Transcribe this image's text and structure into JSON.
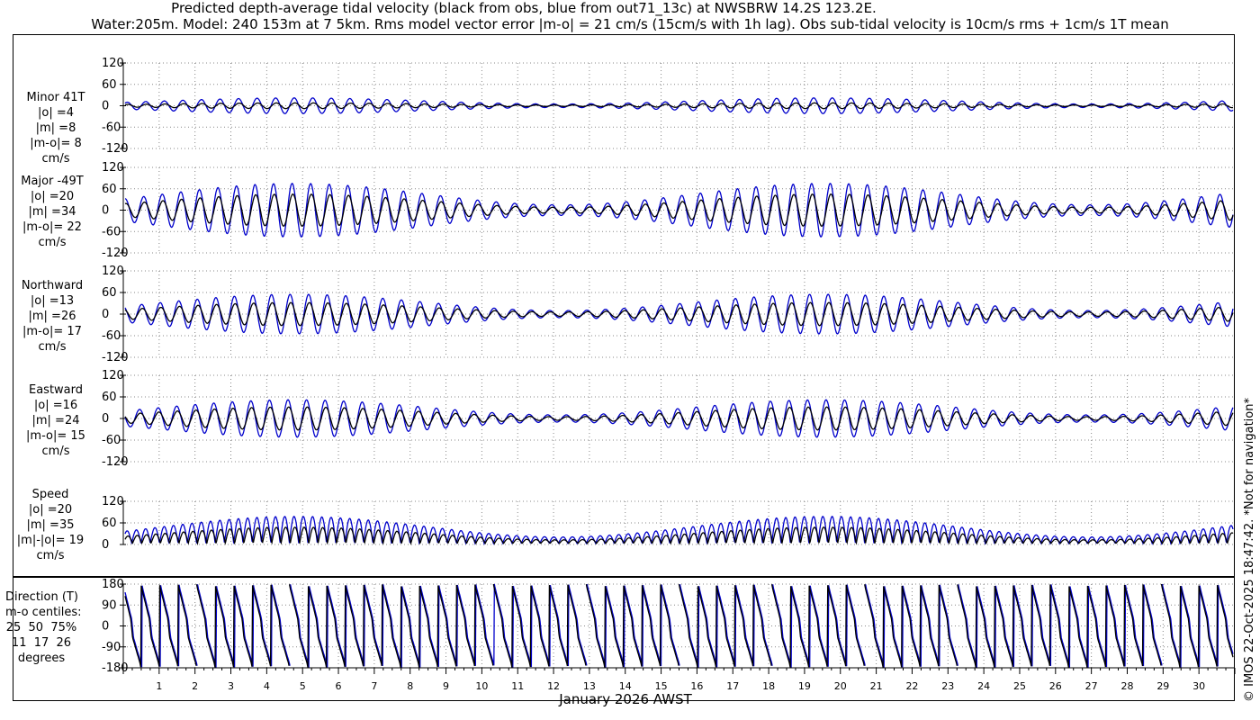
{
  "title_line1": "Predicted depth-average tidal velocity (black from obs, blue from out71_13c) at NWSBRW 14.2S 123.2E.",
  "title_line2": "Water:205m. Model: 240 153m at 7 5km. Rms model vector error |m-o| = 21 cm/s (15cm/s with 1h lag). Obs sub-tidal velocity is 10cm/s rms + 1cm/s 1T mean",
  "xlabel": "January 2026 AWST",
  "copyright": "© IMOS 22-Oct-2025 18:47:42. *Not for navigation*",
  "colors": {
    "obs": "#000000",
    "model": "#0000cc",
    "grid": "#888888"
  },
  "chart_data": [
    {
      "type": "line",
      "name_label": [
        "Minor 41T",
        "|o| =4",
        "|m| =8",
        "|m-o|= 8",
        "cm/s"
      ],
      "yticks": [
        -120,
        -60,
        0,
        60,
        120
      ],
      "ylim": [
        -120,
        120
      ],
      "xlim": [
        0,
        31
      ],
      "xticks": [
        1,
        2,
        3,
        4,
        5,
        6,
        7,
        8,
        9,
        10,
        11,
        12,
        13,
        14,
        15,
        16,
        17,
        18,
        19,
        20,
        21,
        22,
        23,
        24,
        25,
        26,
        27,
        28,
        29,
        30
      ],
      "series": [
        {
          "amplitude_peak": 8,
          "amplitude_neap": 2
        },
        {
          "amplitude_peak": 22,
          "amplitude_neap": 5
        }
      ]
    },
    {
      "type": "line",
      "name_label": [
        "Major -49T",
        "|o| =20",
        "|m| =34",
        "|m-o|= 22",
        "cm/s"
      ],
      "yticks": [
        -120,
        -60,
        0,
        60,
        120
      ],
      "ylim": [
        -120,
        120
      ],
      "series": [
        {
          "amplitude_peak": 45,
          "amplitude_neap": 8
        },
        {
          "amplitude_peak": 75,
          "amplitude_neap": 15
        }
      ]
    },
    {
      "type": "line",
      "name_label": [
        "Northward",
        "|o| =13",
        "|m| =26",
        "|m-o|= 17",
        "cm/s"
      ],
      "yticks": [
        -120,
        -60,
        0,
        60,
        120
      ],
      "ylim": [
        -120,
        120
      ],
      "series": [
        {
          "amplitude_peak": 32,
          "amplitude_neap": 6
        },
        {
          "amplitude_peak": 55,
          "amplitude_neap": 10
        }
      ]
    },
    {
      "type": "line",
      "name_label": [
        "Eastward",
        "|o| =16",
        "|m| =24",
        "|m-o|= 15",
        "cm/s"
      ],
      "yticks": [
        -120,
        -60,
        0,
        60,
        120
      ],
      "ylim": [
        -120,
        120
      ],
      "series": [
        {
          "amplitude_peak": 32,
          "amplitude_neap": 5
        },
        {
          "amplitude_peak": 52,
          "amplitude_neap": 10
        }
      ]
    },
    {
      "type": "line",
      "name_label": [
        "Speed",
        "|o| =20",
        "|m| =35",
        "|m|-|o|= 19",
        "cm/s"
      ],
      "yticks": [
        0,
        60,
        120
      ],
      "ylim": [
        0,
        120
      ],
      "series": [
        {
          "amplitude_peak": 45,
          "amplitude_neap": 10
        },
        {
          "amplitude_peak": 75,
          "amplitude_neap": 18
        }
      ]
    },
    {
      "type": "line",
      "name_label": [
        "Direction (T)",
        "m-o centiles:",
        "25  50  75%",
        "11  17  26",
        "degrees"
      ],
      "yticks": [
        -180,
        -90,
        0,
        90,
        180
      ],
      "ylim": [
        -180,
        180
      ],
      "series": [
        {
          "phase_offset": 0.05
        },
        {
          "phase_offset": 0.0
        }
      ]
    }
  ],
  "tick_labels_x": [
    "1",
    "2",
    "3",
    "4",
    "5",
    "6",
    "7",
    "8",
    "9",
    "10",
    "11",
    "12",
    "13",
    "14",
    "15",
    "16",
    "17",
    "18",
    "19",
    "20",
    "21",
    "22",
    "23",
    "24",
    "25",
    "26",
    "27",
    "28",
    "29",
    "30"
  ]
}
